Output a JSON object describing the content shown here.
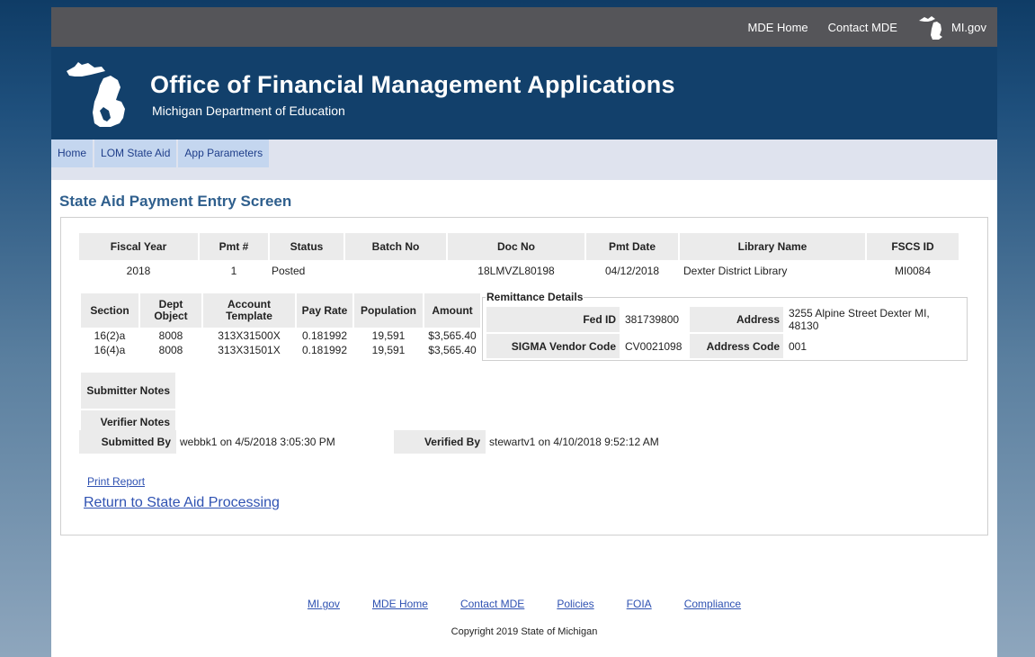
{
  "topbar": {
    "mde_home": "MDE Home",
    "contact_mde": "Contact MDE",
    "migov": "MI.gov"
  },
  "header": {
    "title": "Office of Financial Management Applications",
    "subtitle": "Michigan Department of Education"
  },
  "nav": {
    "items": [
      "Home",
      "LOM State Aid",
      "App Parameters"
    ]
  },
  "page_title": "State Aid Payment Entry Screen",
  "payment": {
    "headers": [
      "Fiscal Year",
      "Pmt #",
      "Status",
      "Batch No",
      "Doc No",
      "Pmt Date",
      "Library Name",
      "FSCS ID"
    ],
    "row": [
      "2018",
      "1",
      "Posted",
      "",
      "18LMVZL80198",
      "04/12/2018",
      "Dexter District Library",
      "MI0084"
    ]
  },
  "sections": {
    "headers": [
      "Section",
      "Dept Object",
      "Account Template",
      "Pay Rate",
      "Population",
      "Amount"
    ],
    "rows": [
      [
        "16(2)a",
        "8008",
        "313X31500X",
        "0.181992",
        "19,591",
        "$3,565.40"
      ],
      [
        "16(4)a",
        "8008",
        "313X31501X",
        "0.181992",
        "19,591",
        "$3,565.40"
      ]
    ]
  },
  "remittance": {
    "legend": "Remittance Details",
    "fed_id_label": "Fed ID",
    "fed_id": "381739800",
    "address_label": "Address",
    "address": "3255 Alpine Street Dexter MI, 48130",
    "vendor_label": "SIGMA Vendor Code",
    "vendor": "CV0021098",
    "address_code_label": "Address Code",
    "address_code": "001"
  },
  "notes": {
    "submitter_label": "Submitter Notes",
    "verifier_label": "Verifier Notes"
  },
  "submitted": {
    "label": "Submitted By",
    "value": "webbk1 on 4/5/2018 3:05:30 PM"
  },
  "verified": {
    "label": "Verified By",
    "value": "stewartv1 on 4/10/2018 9:52:12 AM"
  },
  "links": {
    "print": "Print Report",
    "return": "Return to State Aid Processing"
  },
  "footer": {
    "links": [
      "MI.gov",
      "MDE Home",
      "Contact MDE",
      "Policies",
      "FOIA",
      "Compliance"
    ],
    "copyright": "Copyright 2019 State of Michigan"
  },
  "icons": {
    "state_logo": "michigan-map-icon",
    "small_logo": "michigan-map-icon"
  }
}
